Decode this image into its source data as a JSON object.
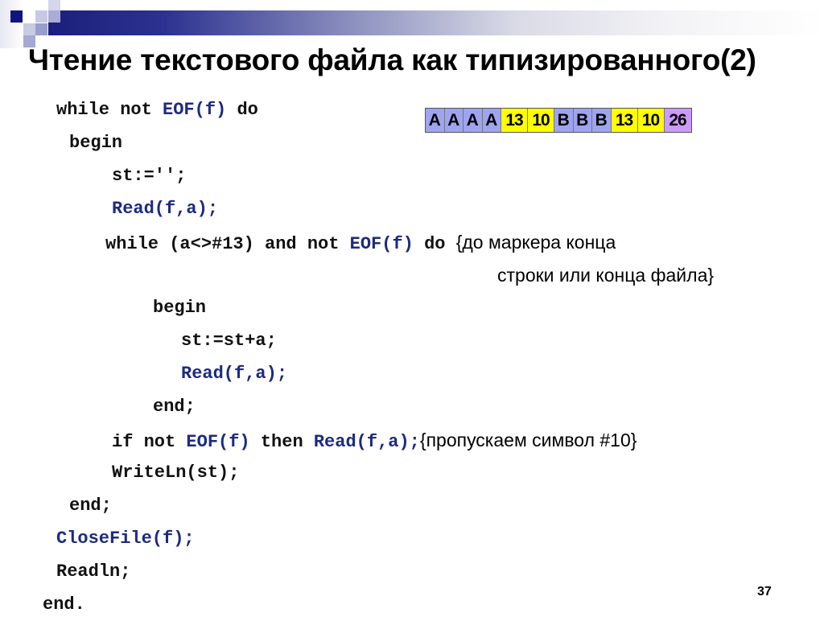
{
  "slide": {
    "title": "Чтение текстового файла как типизированного(2)",
    "page_number": "37"
  },
  "byte_diagram": {
    "cells": [
      {
        "label": "A",
        "kind": "letter",
        "color": "#9fa4f0"
      },
      {
        "label": "A",
        "kind": "letter",
        "color": "#9fa4f0"
      },
      {
        "label": "A",
        "kind": "letter",
        "color": "#9fa4f0"
      },
      {
        "label": "A",
        "kind": "letter",
        "color": "#9fa4f0"
      },
      {
        "label": "13",
        "kind": "num",
        "color": "#ffff00"
      },
      {
        "label": "10",
        "kind": "num",
        "color": "#ffff00"
      },
      {
        "label": "B",
        "kind": "letter",
        "color": "#9fa4f0"
      },
      {
        "label": "B",
        "kind": "letter",
        "color": "#9fa4f0"
      },
      {
        "label": "B",
        "kind": "letter",
        "color": "#9fa4f0"
      },
      {
        "label": "13",
        "kind": "num",
        "color": "#ffff00"
      },
      {
        "label": "10",
        "kind": "num",
        "color": "#ffff00"
      },
      {
        "label": "26",
        "kind": "num",
        "color": "#cc99ff"
      }
    ]
  },
  "code": {
    "l1": {
      "a": "while not ",
      "b": "EOF(f)",
      "c": " do"
    },
    "l2": {
      "a": "begin"
    },
    "l3": {
      "a": "st:='';"
    },
    "l4": {
      "b": "Read(f,a);"
    },
    "l5": {
      "a": "while (a<>#13) and not ",
      "b": "EOF(f)",
      "c": " do ",
      "comment": "{до маркера конца"
    },
    "l5b": {
      "comment": "строки или конца файла}"
    },
    "l6": {
      "a": "begin"
    },
    "l7": {
      "a": "st:=st+a;"
    },
    "l8": {
      "b": "Read(f,a);"
    },
    "l9": {
      "a": "end;"
    },
    "l10": {
      "a": "if not ",
      "b": "EOF(f)",
      "c": " then ",
      "d": "Read(f,a);",
      "comment": "{пропускаем символ #10}"
    },
    "l11": {
      "a": "WriteLn(st);"
    },
    "l12": {
      "a": "end;"
    },
    "l13": {
      "b": "CloseFile(f);"
    },
    "l14": {
      "a": "Readln;"
    },
    "l15": {
      "a": "end."
    }
  },
  "colors": {
    "keyword_blue": "#1c2a80",
    "banner_navy": "#1b1f7c"
  }
}
